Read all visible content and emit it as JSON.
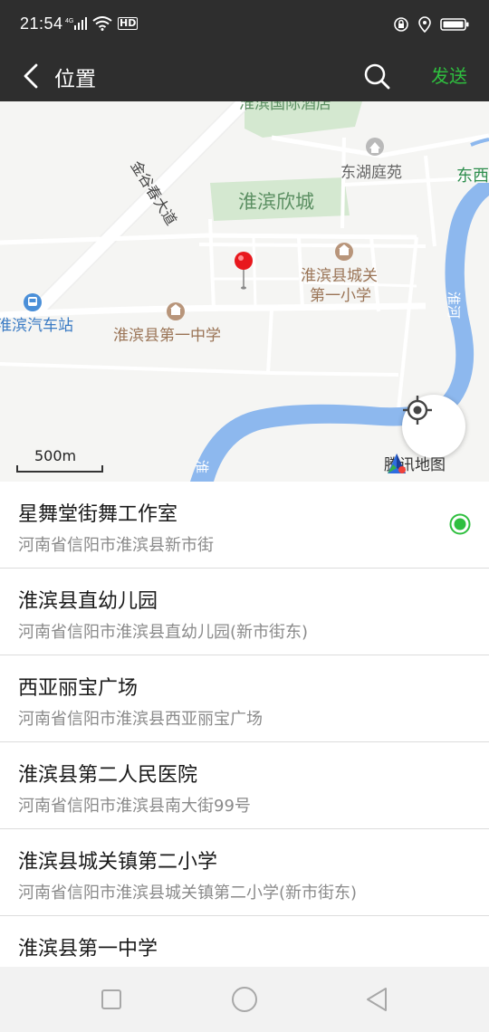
{
  "status_bar": {
    "time": "21:54",
    "network": "4G",
    "hd": "HD"
  },
  "header": {
    "title": "位置",
    "send_label": "发送"
  },
  "map": {
    "labels": {
      "fragment_top": "淮滨国际酒店",
      "avenue": "金谷春大道",
      "east_lake": "东湖庭苑",
      "east_edge": "东西",
      "xincheng": "淮滨欣城",
      "chengguan_line1": "淮滨县城关",
      "chengguan_line2": "第一小学",
      "bus_station": "淮滨汽车站",
      "first_middle": "淮滨县第一中学",
      "river_huaihe": "淮河",
      "river_bottom": "淮"
    },
    "scale": "500m",
    "provider": "腾讯地图"
  },
  "locations": [
    {
      "title": "星舞堂街舞工作室",
      "address": "河南省信阳市淮滨县新市街",
      "selected": true
    },
    {
      "title": "淮滨县直幼儿园",
      "address": "河南省信阳市淮滨县直幼儿园(新市街东)",
      "selected": false
    },
    {
      "title": "西亚丽宝广场",
      "address": "河南省信阳市淮滨县西亚丽宝广场",
      "selected": false
    },
    {
      "title": "淮滨县第二人民医院",
      "address": "河南省信阳市淮滨县南大街99号",
      "selected": false
    },
    {
      "title": "淮滨县城关镇第二小学",
      "address": "河南省信阳市淮滨县城关镇第二小学(新市街东)",
      "selected": false
    },
    {
      "title": "淮滨县第一中学",
      "address": "",
      "selected": false
    }
  ],
  "colors": {
    "accent": "#2fbf3f",
    "header_bg": "#2e2e2e",
    "river": "#8db8ee",
    "pin": "#e8181d"
  },
  "icons": [
    "back-icon",
    "search-icon",
    "locate-icon",
    "map-pin-icon",
    "square-icon",
    "circle-icon",
    "triangle-back-icon"
  ]
}
